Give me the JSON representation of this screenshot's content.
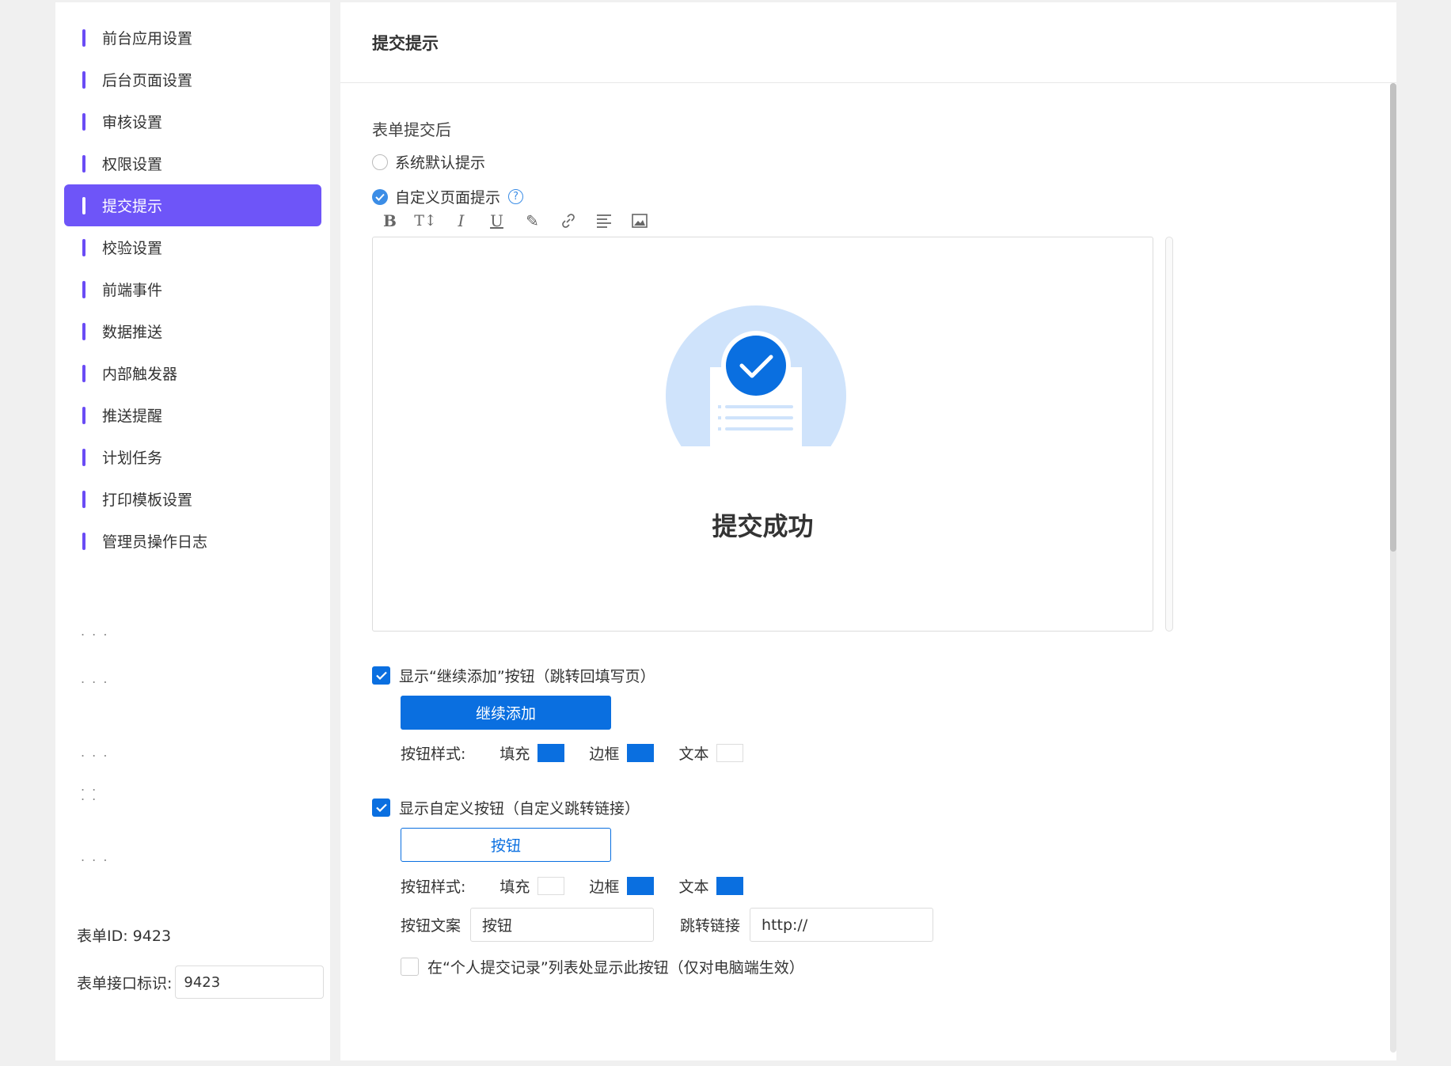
{
  "sidebar": {
    "items": [
      {
        "label": "前台应用设置"
      },
      {
        "label": "后台页面设置"
      },
      {
        "label": "审核设置"
      },
      {
        "label": "权限设置"
      },
      {
        "label": "提交提示"
      },
      {
        "label": "校验设置"
      },
      {
        "label": "前端事件"
      },
      {
        "label": "数据推送"
      },
      {
        "label": "内部触发器"
      },
      {
        "label": "推送提醒"
      },
      {
        "label": "计划任务"
      },
      {
        "label": "打印模板设置"
      },
      {
        "label": "管理员操作日志"
      }
    ],
    "active_index": 4,
    "ellipsis": ". . .",
    "ellipsis_stacked": ". .\n. .",
    "form_id": "表单ID: 9423",
    "form_key_label": "表单接口标识:",
    "form_key_value": "9423"
  },
  "main": {
    "title": "提交提示",
    "after_submit_label": "表单提交后",
    "radio_default": "系统默认提示",
    "radio_custom": "自定义页面提示",
    "help_glyph": "?",
    "toolbar": [
      "bold-icon",
      "text-size-icon",
      "italic-icon",
      "underline-icon",
      "highlighter-icon",
      "link-icon",
      "align-left-icon",
      "image-icon"
    ],
    "toolbar_glyphs": [
      "B",
      "T↕",
      "I",
      "U",
      "✎",
      "🔗",
      "≡",
      "▣"
    ],
    "success_text": "提交成功",
    "check_continue": "显示“继续添加”按钮（跳转回填写页）",
    "continue_button": "继续添加",
    "style_label": "按钮样式:",
    "fill_label": "填充",
    "border_label": "边框",
    "text_label": "文本",
    "check_custom": "显示自定义按钮（自定义跳转链接）",
    "custom_button": "按钮",
    "button_text_label": "按钮文案",
    "button_text_value": "按钮",
    "link_label": "跳转链接",
    "link_value": "http://",
    "check_record": "在“个人提交记录”列表处显示此按钮（仅对电脑端生效）"
  },
  "colors": {
    "accent_purple": "#6e55f8",
    "primary_blue": "#0a6fe0",
    "swatch_blue": "#0a6fe0",
    "swatch_white": "#ffffff"
  }
}
